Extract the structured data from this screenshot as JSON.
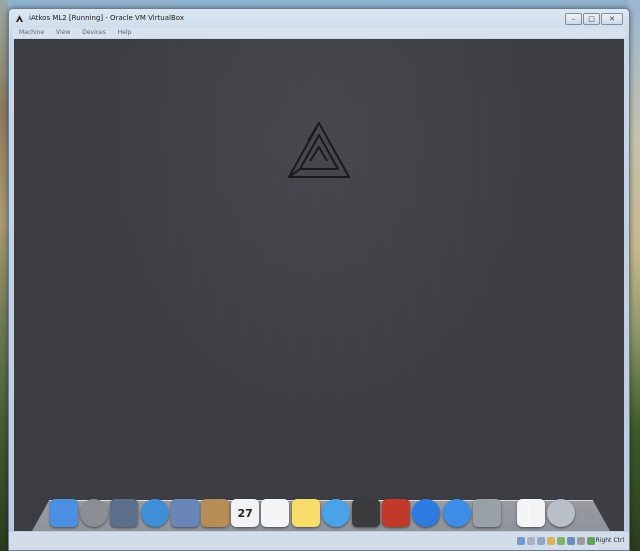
{
  "window": {
    "title": "iAtkos ML2 [Running] - Oracle VM VirtualBox",
    "minimize_icon": "minimize-icon",
    "maximize_icon": "maximize-icon",
    "close_icon": "close-icon"
  },
  "menu": {
    "items": [
      "Machine",
      "View",
      "Devices",
      "Help"
    ]
  },
  "guest": {
    "logo_icon": "impossible-triangle-logo"
  },
  "dock": {
    "items": [
      {
        "name": "finder",
        "icon": "finder-icon",
        "color": "#4a90e2"
      },
      {
        "name": "launchpad",
        "icon": "rocket-icon",
        "color": "#8a8f96"
      },
      {
        "name": "mission-control",
        "icon": "mission-control-icon",
        "color": "#5b6f8a"
      },
      {
        "name": "safari",
        "icon": "compass-icon",
        "color": "#3f8fd8"
      },
      {
        "name": "mail",
        "icon": "stamp-icon",
        "color": "#6a86b8"
      },
      {
        "name": "contacts",
        "icon": "address-book-icon",
        "color": "#b68d55"
      },
      {
        "name": "calendar",
        "icon": "calendar-icon",
        "color": "#f2f2f2",
        "label": "27"
      },
      {
        "name": "reminders",
        "icon": "checklist-icon",
        "color": "#f5f5f5"
      },
      {
        "name": "notes",
        "icon": "notes-icon",
        "color": "#f7dd6a"
      },
      {
        "name": "messages",
        "icon": "speech-bubble-icon",
        "color": "#4aa3e8"
      },
      {
        "name": "facetime",
        "icon": "camera-icon",
        "color": "#3c3c3c"
      },
      {
        "name": "photo-booth",
        "icon": "photo-booth-icon",
        "color": "#c0392b"
      },
      {
        "name": "itunes",
        "icon": "music-note-icon",
        "color": "#2d7be0"
      },
      {
        "name": "app-store",
        "icon": "app-store-icon",
        "color": "#3c8ee6"
      },
      {
        "name": "system-preferences",
        "icon": "gear-icon",
        "color": "#9aa0a8"
      },
      {
        "name": "document-stack",
        "icon": "document-icon",
        "color": "#f4f4f4"
      },
      {
        "name": "trash",
        "icon": "trash-icon",
        "color": "#b9bfc7"
      }
    ]
  },
  "status_bar": {
    "indicators": [
      {
        "icon": "hard-disk-icon",
        "color": "#6f9bd1"
      },
      {
        "icon": "optical-drive-icon",
        "color": "#a9b3bf"
      },
      {
        "icon": "usb-icon",
        "color": "#8fa7c3"
      },
      {
        "icon": "shared-folder-icon",
        "color": "#d9b25a"
      },
      {
        "icon": "network-icon",
        "color": "#7cb56a"
      },
      {
        "icon": "display-icon",
        "color": "#6c8fb8"
      },
      {
        "icon": "video-capture-icon",
        "color": "#9c9c9c"
      },
      {
        "icon": "keyboard-capture-icon",
        "color": "#5fa25f"
      }
    ],
    "host_key": "Right Ctrl"
  }
}
